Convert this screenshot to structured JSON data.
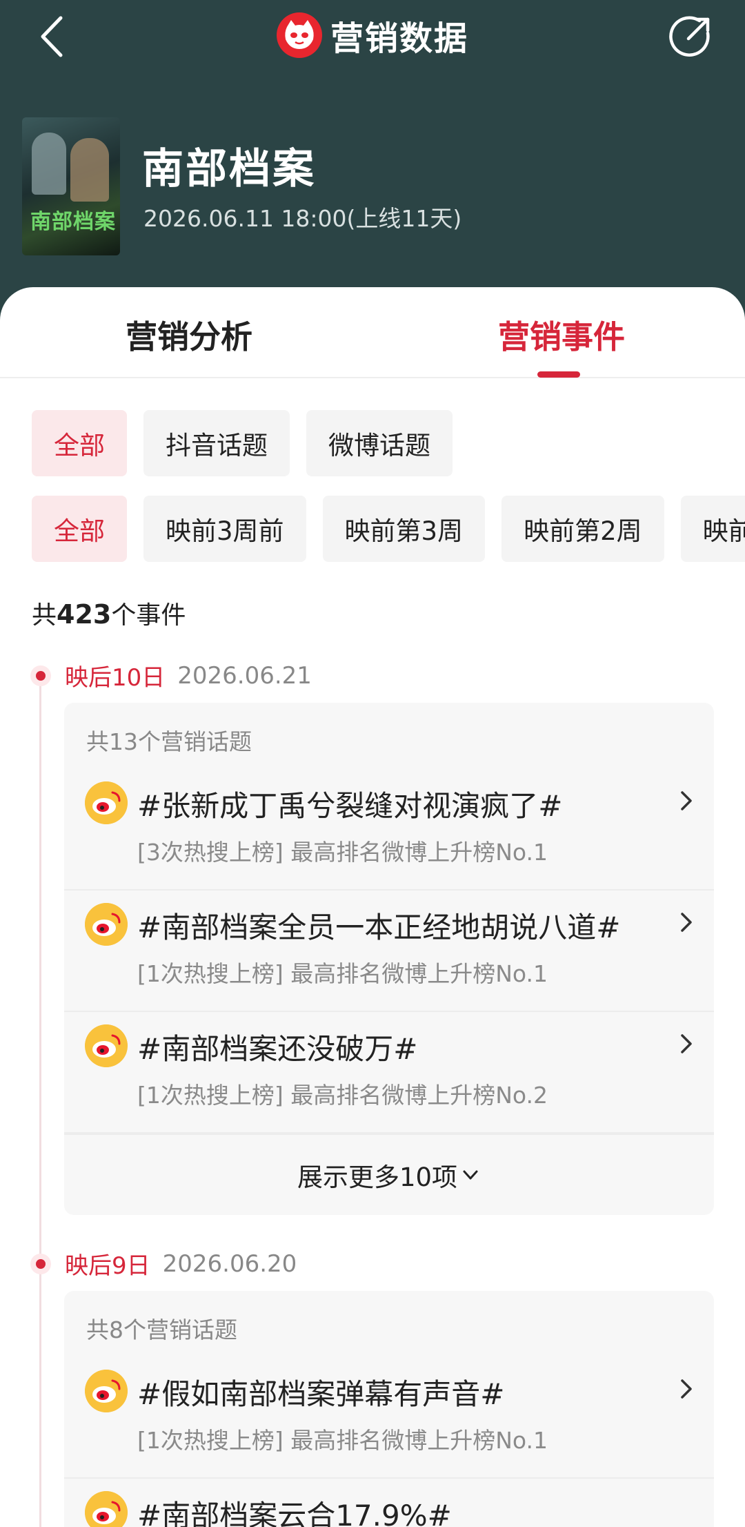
{
  "header": {
    "title": "营销数据",
    "accent": "#e8262e",
    "background": "#2b4445"
  },
  "movie": {
    "name": "南部档案",
    "release": "2026.06.11 18:00(上线11天)"
  },
  "tabs": [
    {
      "label": "营销分析",
      "active": false
    },
    {
      "label": "营销事件",
      "active": true
    }
  ],
  "filters": {
    "platform": [
      "全部",
      "抖音话题",
      "微博话题"
    ],
    "period": [
      "全部",
      "映前3周前",
      "映前第3周",
      "映前第2周",
      "映前"
    ]
  },
  "summary": {
    "prefix": "共",
    "count": "423",
    "suffix": "个事件"
  },
  "events": [
    {
      "day_label": "映后10日",
      "date": "2026.06.21",
      "topic_count": "共13个营销话题",
      "topics": [
        {
          "title": "#张新成丁禹兮裂缝对视演疯了#",
          "detail": "[3次热搜上榜] 最高排名微博上升榜No.1"
        },
        {
          "title": "#南部档案全员一本正经地胡说八道#",
          "detail": "[1次热搜上榜] 最高排名微博上升榜No.1"
        },
        {
          "title": "#南部档案还没破万#",
          "detail": "[1次热搜上榜] 最高排名微博上升榜No.2"
        }
      ],
      "show_more": "展示更多10项"
    },
    {
      "day_label": "映后9日",
      "date": "2026.06.20",
      "topic_count": "共8个营销话题",
      "topics": [
        {
          "title": "#假如南部档案弹幕有声音#",
          "detail": "[1次热搜上榜] 最高排名微博上升榜No.1"
        },
        {
          "title": "#南部档案云合17.9%#",
          "detail": ""
        }
      ]
    }
  ]
}
